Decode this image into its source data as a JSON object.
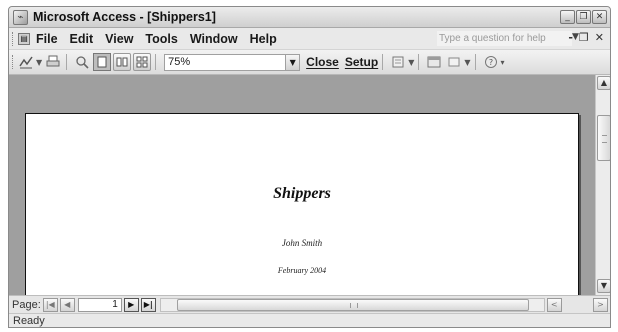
{
  "window": {
    "title": "Microsoft Access - [Shippers1]",
    "controls": {
      "minimize": "_",
      "restore": "❐",
      "close": "✕"
    }
  },
  "menubar": {
    "items": [
      "File",
      "Edit",
      "View",
      "Tools",
      "Window",
      "Help"
    ],
    "help_placeholder": "Type a question for help",
    "mdi_minimize": "-",
    "mdi_restore": "❐",
    "mdi_close": "✕"
  },
  "toolbar": {
    "zoom_value": "75%",
    "close_label": "Close",
    "setup_label": "Setup",
    "icons": [
      "view-icon",
      "print-icon",
      "zoom-icon",
      "one-page-icon",
      "two-pages-icon",
      "multiple-pages-icon",
      "office-links-icon",
      "database-window-icon",
      "new-object-icon",
      "help-icon"
    ]
  },
  "report": {
    "title": "Shippers",
    "author": "John Smith",
    "date": "February 2004"
  },
  "navigation": {
    "label": "Page:",
    "page_number": "1"
  },
  "status": {
    "text": "Ready"
  }
}
